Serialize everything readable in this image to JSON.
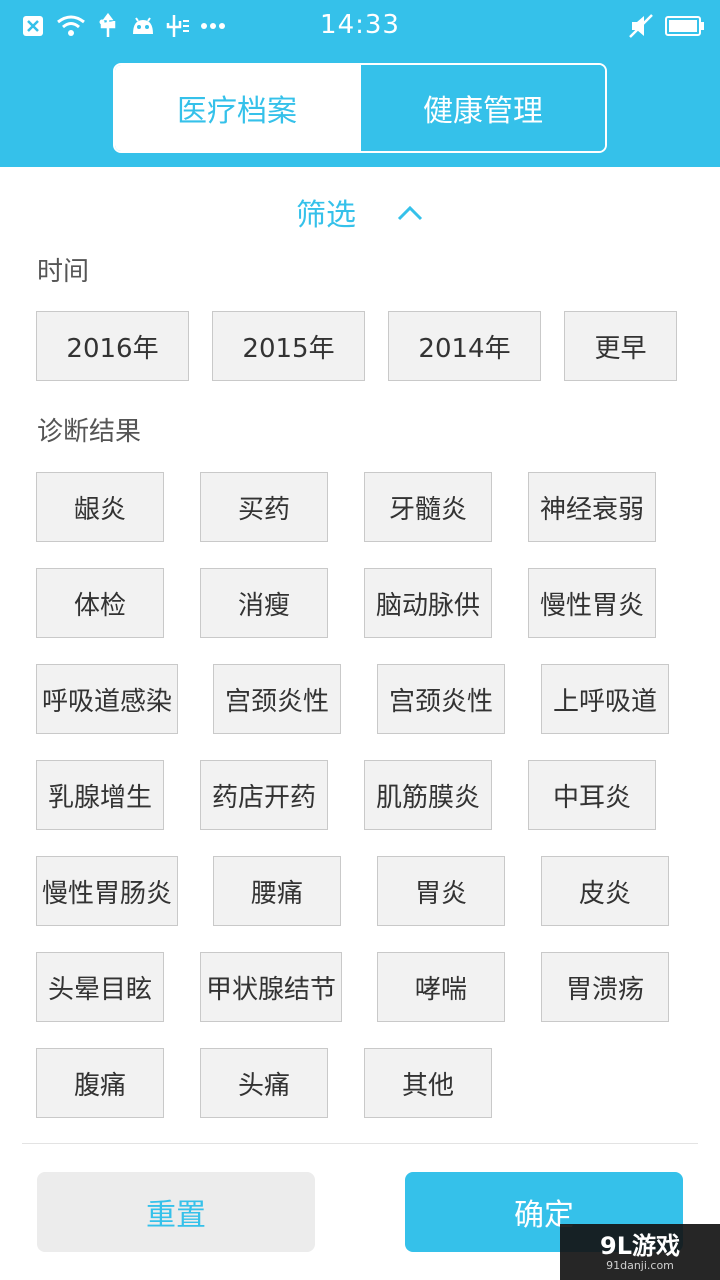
{
  "status_bar": {
    "time": "14:33",
    "left_icons": [
      "close-box-icon",
      "wifi-icon",
      "usb-icon",
      "android-icon",
      "usb-debug-icon",
      "more-dots-icon"
    ],
    "right_icons": [
      "mute-icon",
      "battery-icon"
    ]
  },
  "tabs": {
    "medical_records": "医疗档案",
    "health_management": "健康管理",
    "active": "health_management"
  },
  "filter": {
    "label": "筛选",
    "chevron": "chevron-up-icon"
  },
  "time_section": {
    "label": "时间",
    "options": [
      "2016年",
      "2015年",
      "2014年",
      "更早"
    ]
  },
  "diagnosis_section": {
    "label": "诊断结果",
    "options": [
      "龈炎",
      "买药",
      "牙髓炎",
      "神经衰弱",
      "体检",
      "消瘦",
      "脑动脉供",
      "慢性胃炎",
      "呼吸道感染",
      "宫颈炎性",
      "宫颈炎性",
      "上呼吸道",
      "乳腺增生",
      "药店开药",
      "肌筋膜炎",
      "中耳炎",
      "慢性胃肠炎",
      "腰痛",
      "胃炎",
      "皮炎",
      "头晕目眩",
      "甲状腺结节",
      "哮喘",
      "胃溃疡",
      "腹痛",
      "头痛",
      "其他"
    ]
  },
  "actions": {
    "reset": "重置",
    "confirm": "确定"
  },
  "watermark": {
    "main": "9L游戏",
    "sub": "91danji.com"
  },
  "colors": {
    "accent": "#35c1ea",
    "chip_bg": "#f2f2f2",
    "chip_border": "#c9c9c9"
  }
}
